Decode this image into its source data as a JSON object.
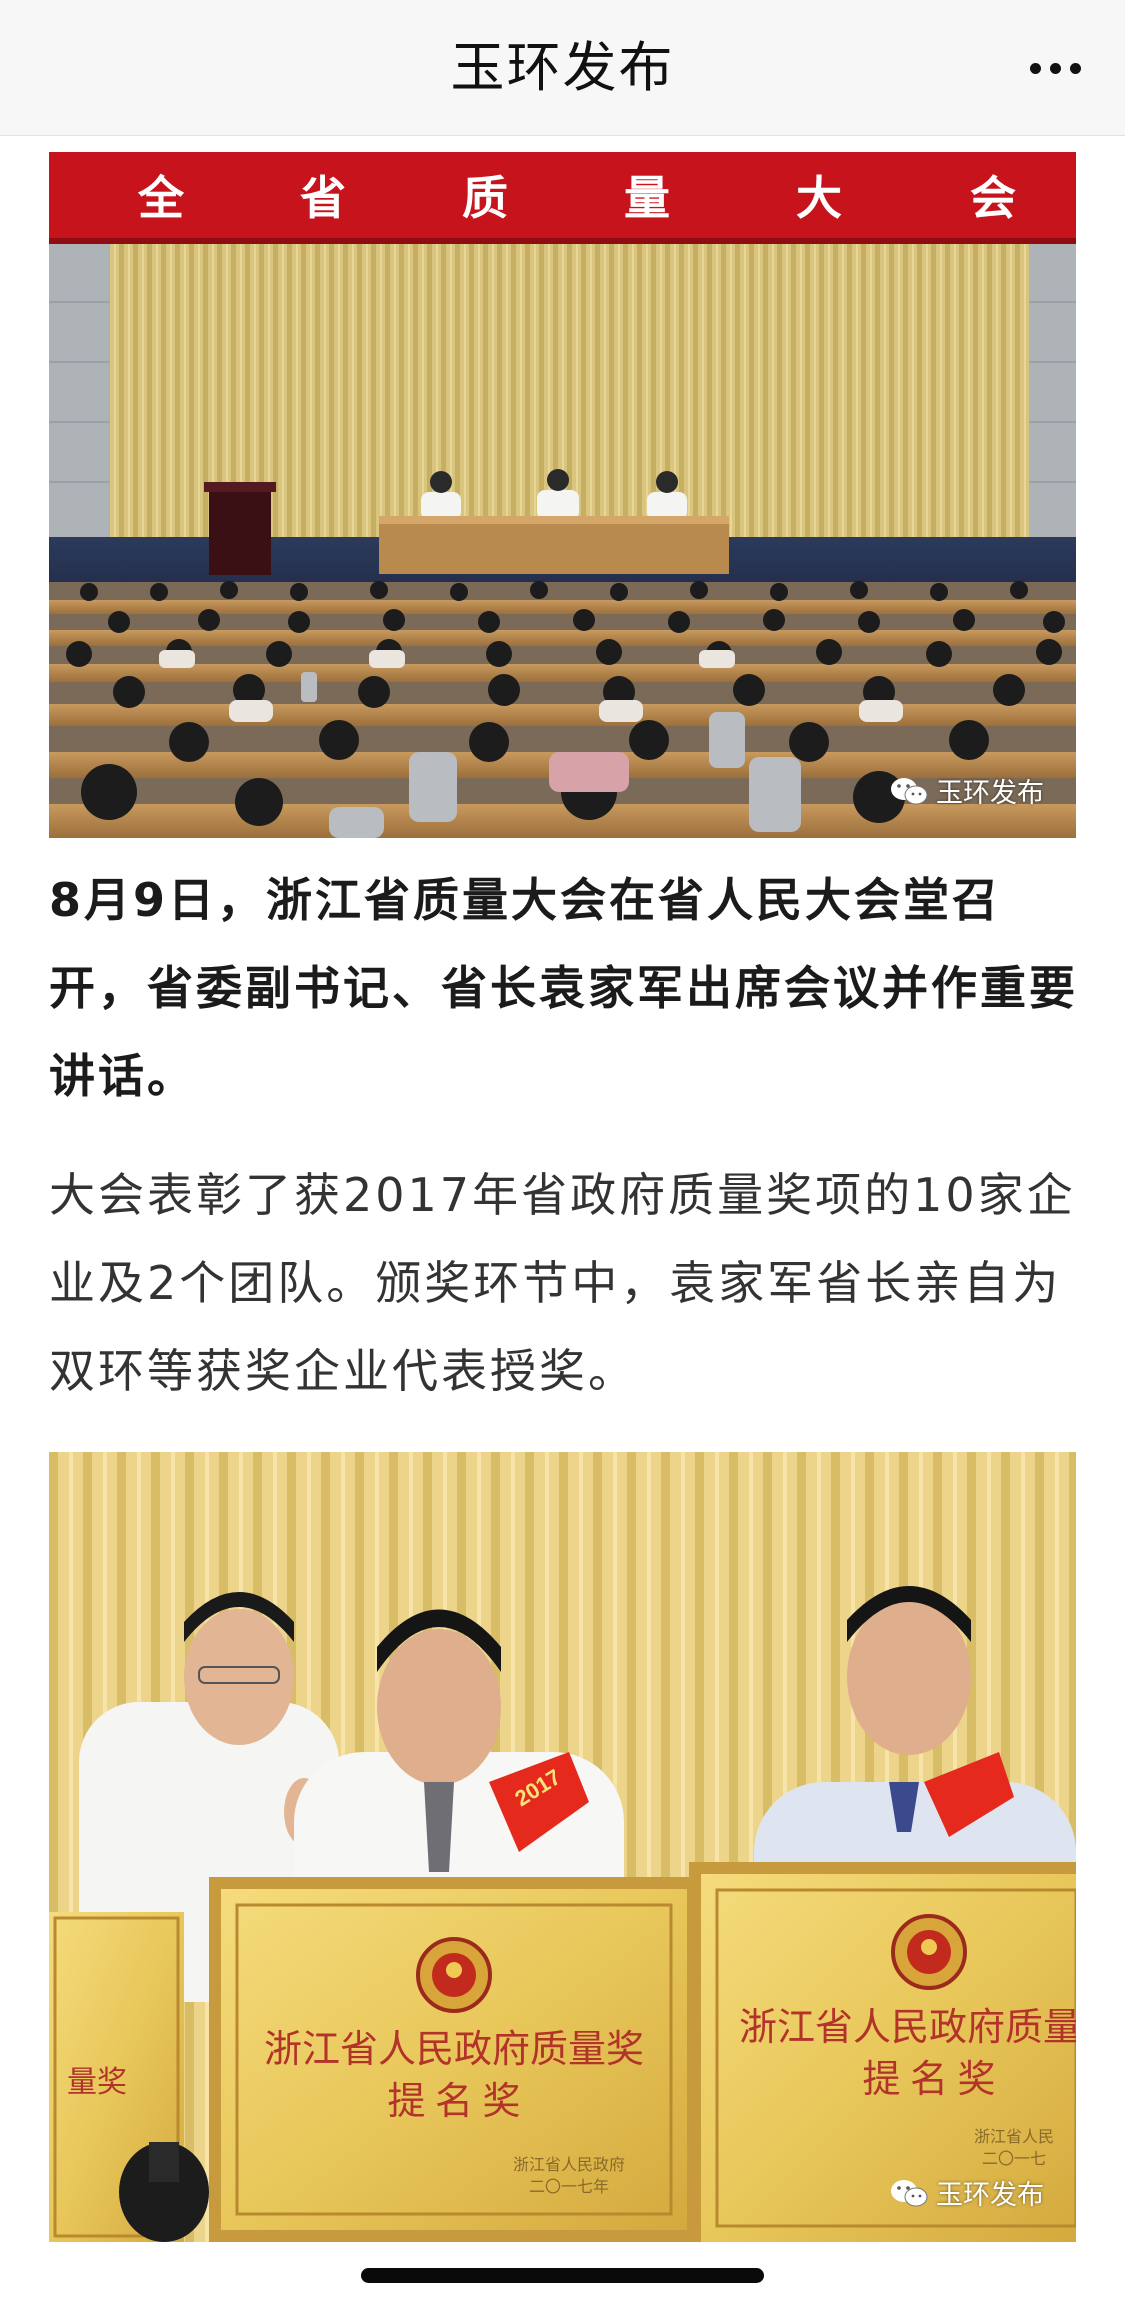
{
  "header": {
    "title": "玉环发布",
    "more_icon": "ellipsis-icon"
  },
  "article": {
    "photo1": {
      "banner_text": "全 省 质 量 大 会",
      "banner_chars": [
        "全",
        "省",
        "质",
        "量",
        "大",
        "会"
      ],
      "watermark": "玉环发布"
    },
    "paragraph1": "8月9日，浙江省质量大会在省人民大会堂召开，省委副书记、省长袁家军出席会议并作重要讲话。",
    "paragraph2": "大会表彰了获2017年省政府质量奖项的10家企业及2个团队。颁奖环节中，袁家军省长亲自为双环等获奖企业代表授奖。",
    "photo2": {
      "plaque_left_title": "浙江省人民政府质量奖",
      "plaque_left_subtitle": "提 名 奖",
      "plaque_left_footer_1": "浙江省人民政府",
      "plaque_left_footer_2": "二〇一七年",
      "plaque_right_title": "浙江省人民政府质量",
      "plaque_right_subtitle": "提 名 奖",
      "plaque_right_footer_1": "浙江省人民",
      "plaque_right_footer_2": "二〇一七",
      "plaque_edge_text": "量奖",
      "sash_text": "2017",
      "watermark": "玉环发布"
    }
  },
  "colors": {
    "banner_red": "#c7141c",
    "curtain_gold": "#d8c27a",
    "plaque_gold": "#e8c75a",
    "plaque_text_red": "#b2332a"
  }
}
